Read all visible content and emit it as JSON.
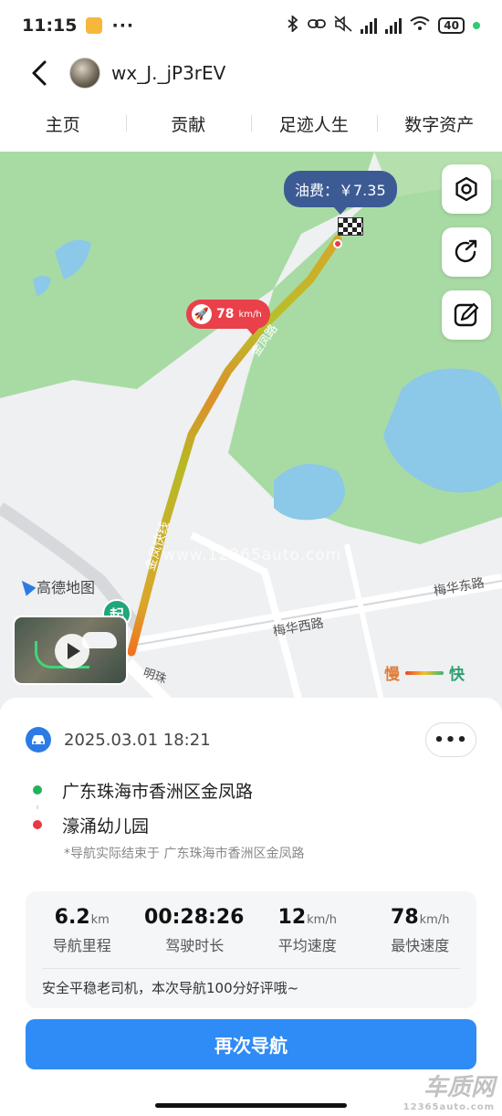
{
  "status_bar": {
    "time": "11:15",
    "dots": "···",
    "battery": "40"
  },
  "header": {
    "back_icon": "back-arrow-icon",
    "username": "wx_J._jP3rEV"
  },
  "tabs": [
    "主页",
    "贡献",
    "足迹人生",
    "数字资产"
  ],
  "map": {
    "fuel_fee": "油费：￥7.35",
    "max_speed_value": "78",
    "max_speed_unit": "km/h",
    "start_badge": "起",
    "brand": "高德地图",
    "watermark": "www.12365auto.com",
    "road_labels": [
      "梅华西路",
      "梅华东路",
      "金凤快线",
      "金凤路",
      "明珠"
    ],
    "legend_slow": "慢",
    "legend_fast": "快",
    "buttons": [
      "settings-icon",
      "share-icon",
      "edit-icon"
    ]
  },
  "trip": {
    "date": "2025.03.01 18:21",
    "more": "•••",
    "start": "广东珠海市香洲区金凤路",
    "end": "濠涌幼儿园",
    "note": "*导航实际结束于 广东珠海市香洲区金凤路"
  },
  "stats": [
    {
      "value": "6.2",
      "unit": "km",
      "label": "导航里程"
    },
    {
      "value": "00:28:26",
      "unit": "",
      "label": "驾驶时长"
    },
    {
      "value": "12",
      "unit": "km/h",
      "label": "平均速度"
    },
    {
      "value": "78",
      "unit": "km/h",
      "label": "最快速度"
    }
  ],
  "comment": "安全平稳老司机，本次导航100分好评哦~",
  "renav_button": "再次导航",
  "watermark": {
    "main": "车质网",
    "sub": "12365auto.com"
  },
  "colors": {
    "accent": "#2f8bf5",
    "fee_bubble": "#3c5b95",
    "speed_bubble": "#e9404a",
    "start_green": "#21a57a",
    "end_red": "#e63946"
  }
}
